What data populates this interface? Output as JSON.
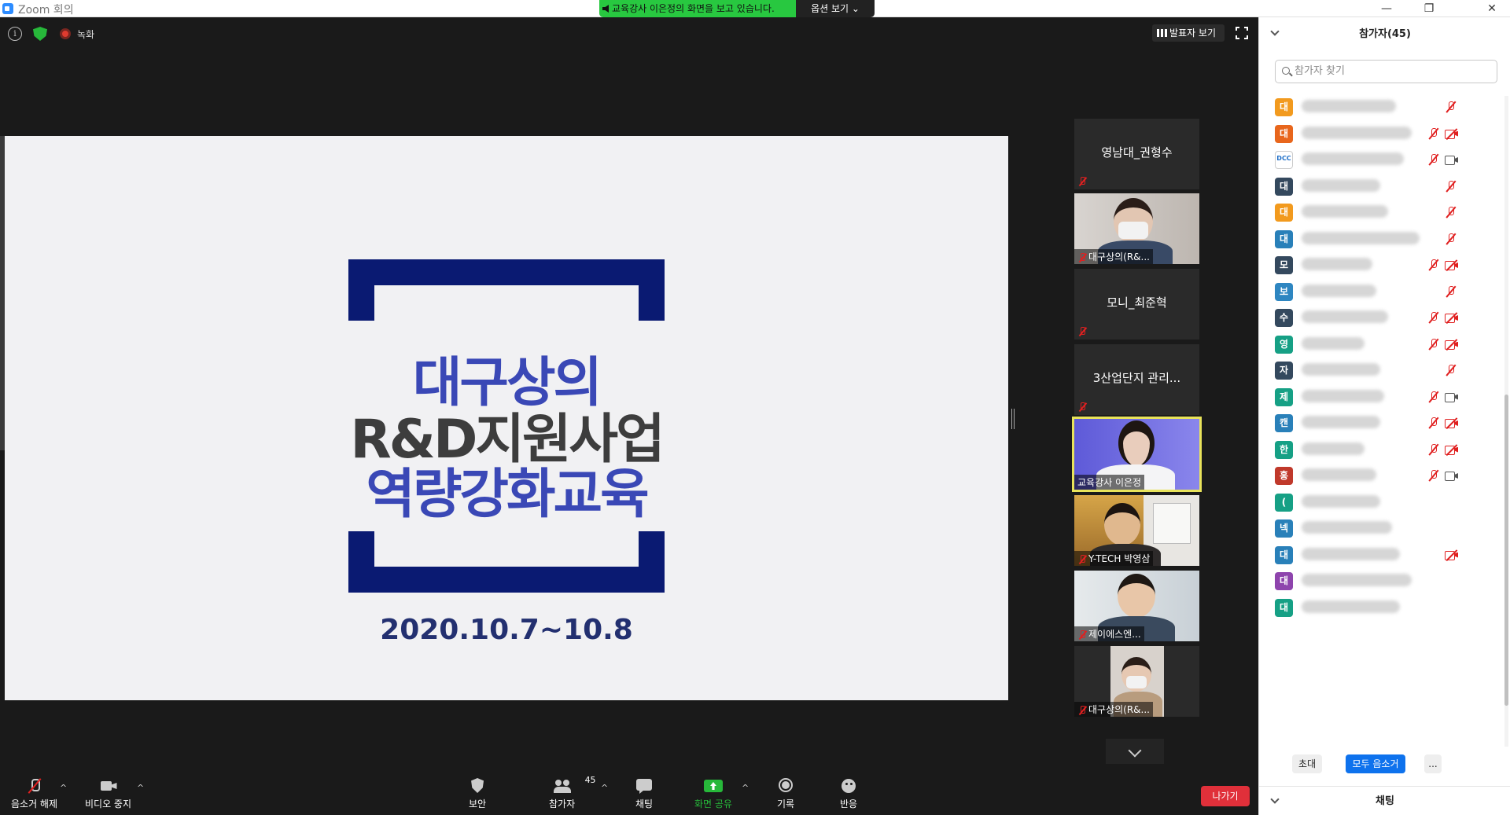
{
  "window": {
    "title": "Zoom 회의"
  },
  "share_banner": {
    "message": "교육강사 이은정의 화면을 보고 있습니다.",
    "options_label": "옵션 보기 ⌄"
  },
  "meeting_header": {
    "record_label": "녹화",
    "speaker_view_label": "발표자 보기"
  },
  "slide": {
    "line1": "대구상의",
    "line2": "R&D지원사업",
    "line3": "역량강화교육",
    "date": "2020.10.7~10.8"
  },
  "thumbnails": [
    {
      "name": "영남대_권형수",
      "type": "name"
    },
    {
      "name": "대구상의(R&...",
      "type": "video"
    },
    {
      "name": "모니_최준혁",
      "type": "name"
    },
    {
      "name": "3산업단지 관리...",
      "type": "name"
    },
    {
      "name": "교육강사 이은정",
      "type": "video",
      "active": true
    },
    {
      "name": "Y-TECH 박영삼",
      "type": "video"
    },
    {
      "name": "제이에스엔...",
      "type": "video"
    },
    {
      "name": "대구상의(R&...",
      "type": "video"
    }
  ],
  "toolbar": {
    "unmute_label": "음소거 해제",
    "stop_video_label": "비디오 중지",
    "security_label": "보안",
    "participants_label": "참가자",
    "participants_count": "45",
    "chat_label": "채팅",
    "share_label": "화면 공유",
    "record_label": "기록",
    "reactions_label": "반응",
    "leave_label": "나가기"
  },
  "panel": {
    "title": "참가자(45)",
    "search_placeholder": "참가자 찾기",
    "invite_label": "초대",
    "mute_all_label": "모두 음소거",
    "more_label": "...",
    "chat_title": "채팅",
    "participants": [
      {
        "initial": "대",
        "color": "#f29a1e",
        "mic": "off",
        "cam": "none"
      },
      {
        "initial": "대",
        "color": "#e8661c",
        "mic": "off",
        "cam": "off"
      },
      {
        "initial": "DCC",
        "color": "image",
        "mic": "off",
        "cam": "on"
      },
      {
        "initial": "대",
        "color": "#34495e",
        "mic": "off",
        "cam": "none"
      },
      {
        "initial": "대",
        "color": "#f29a1e",
        "mic": "off",
        "cam": "none"
      },
      {
        "initial": "대",
        "color": "#2980b9",
        "mic": "off",
        "cam": "none"
      },
      {
        "initial": "모",
        "color": "#34495e",
        "mic": "off",
        "cam": "off"
      },
      {
        "initial": "보",
        "color": "#2e86c1",
        "mic": "off",
        "cam": "none"
      },
      {
        "initial": "수",
        "color": "#34495e",
        "mic": "off",
        "cam": "off"
      },
      {
        "initial": "영",
        "color": "#16a085",
        "mic": "off",
        "cam": "off"
      },
      {
        "initial": "자",
        "color": "#34495e",
        "mic": "off",
        "cam": "none"
      },
      {
        "initial": "제",
        "color": "#16a085",
        "mic": "off",
        "cam": "on"
      },
      {
        "initial": "캔",
        "color": "#2980b9",
        "mic": "off",
        "cam": "off"
      },
      {
        "initial": "한",
        "color": "#16a085",
        "mic": "off",
        "cam": "off"
      },
      {
        "initial": "홍",
        "color": "#c0392b",
        "mic": "off",
        "cam": "on"
      },
      {
        "initial": "(",
        "color": "#16a085",
        "mic": "none",
        "cam": "none"
      },
      {
        "initial": "넥",
        "color": "#2980b9",
        "mic": "none",
        "cam": "none"
      },
      {
        "initial": "대",
        "color": "#2980b9",
        "mic": "none",
        "cam": "off"
      },
      {
        "initial": "대",
        "color": "#8e44ad",
        "mic": "none",
        "cam": "none"
      },
      {
        "initial": "대",
        "color": "#16a085",
        "mic": "none",
        "cam": "none"
      }
    ]
  },
  "colors": {
    "accent": "#0e72ed",
    "share_green": "#27b83a",
    "leave_red": "#e0303a",
    "active_border": "#e8e35a"
  }
}
